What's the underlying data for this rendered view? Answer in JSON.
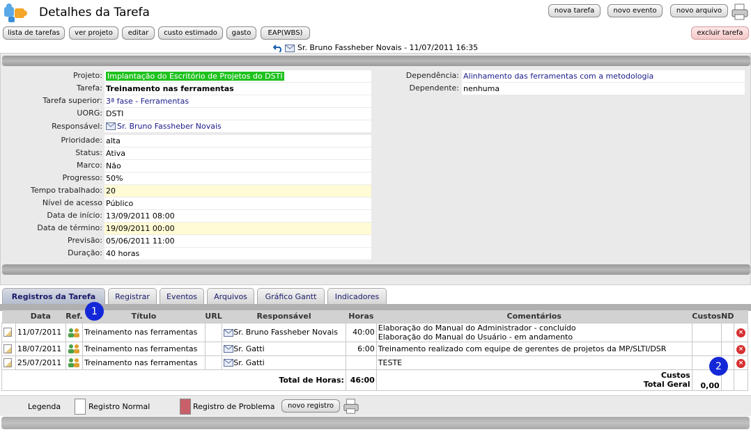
{
  "header": {
    "title": "Detalhes da Tarefa",
    "top_buttons": [
      "nova tarefa",
      "novo evento",
      "novo arquivo"
    ],
    "toolbar": [
      "lista de tarefas",
      "ver projeto",
      "editar",
      "custo estimado",
      "gasto",
      "EAP(WBS)"
    ],
    "delete_button": "excluir tarefa",
    "owner_line": "Sr. Bruno Fassheber Novais - 11/07/2011 16:35"
  },
  "details": {
    "left": [
      {
        "label": "Projeto:",
        "value": "Implantação do Escritório de Projetos do DSTI"
      },
      {
        "label": "Tarefa:",
        "value": "Treinamento nas ferramentas"
      },
      {
        "label": "Tarefa superior:",
        "value": "3ª fase - Ferramentas"
      },
      {
        "label": "UORG:",
        "value": "DSTI"
      },
      {
        "label": "Responsável:",
        "value": "Sr. Bruno Fassheber Novais"
      },
      {
        "label": "Prioridade:",
        "value": "alta"
      },
      {
        "label": "Status:",
        "value": "Ativa"
      },
      {
        "label": "Marco:",
        "value": "Não"
      },
      {
        "label": "Progresso:",
        "value": "50%"
      },
      {
        "label": "Tempo trabalhado:",
        "value": "20"
      },
      {
        "label": "Nível de acesso",
        "value": "Público"
      },
      {
        "label": "Data de início:",
        "value": "13/09/2011 08:00"
      },
      {
        "label": "Data de término:",
        "value": "19/09/2011 00:00"
      },
      {
        "label": "Previsão:",
        "value": "05/06/2011 11:00"
      },
      {
        "label": "Duração:",
        "value": "40 horas"
      }
    ],
    "right": [
      {
        "label": "Dependência:",
        "value": "Alinhamento das ferramentas com a metodologia"
      },
      {
        "label": "Dependente:",
        "value": "nenhuma"
      }
    ]
  },
  "tabs": [
    "Registros da Tarefa",
    "Registrar",
    "Eventos",
    "Arquivos",
    "Gráfico Gantt",
    "Indicadores"
  ],
  "log": {
    "columns": [
      "Data",
      "Ref.",
      "Título",
      "URL",
      "Responsável",
      "Horas",
      "Comentários",
      "Custos",
      "ND"
    ],
    "rows": [
      {
        "date": "11/07/2011",
        "title": "Treinamento nas ferramentas",
        "url": "",
        "owner": "Sr. Bruno Fassheber Novais",
        "hours": "40:00",
        "comment1": "Elaboração do Manual do Administrador - concluído",
        "comment2": "Elaboração do Manual do Usuário - em andamento",
        "cost": ""
      },
      {
        "date": "18/07/2011",
        "title": "Treinamento nas ferramentas",
        "url": "",
        "owner": "Sr. Gatti",
        "hours": "6:00",
        "comment1": "Treinamento realizado com equipe de gerentes de projetos da MP/SLTI/DSR",
        "comment2": "",
        "cost": ""
      },
      {
        "date": "25/07/2011",
        "title": "Treinamento nas ferramentas",
        "url": "",
        "owner": "Sr. Gatti",
        "hours": "",
        "comment1": "TESTE",
        "comment2": "",
        "cost": ""
      }
    ],
    "total_hours_label": "Total de Horas:",
    "total_hours": "46:00",
    "costs_label": "Custos",
    "total_general_label": "Total Geral",
    "total_general": "0,00"
  },
  "legend": {
    "label": "Legenda",
    "normal": "Registro Normal",
    "problem": "Registro de Problema",
    "new_button": "novo registro"
  },
  "badges": [
    "1",
    "2"
  ],
  "colors": {
    "project_highlight": "#1ec21e",
    "problem_swatch": "#c8606a",
    "badge": "#1428d8"
  }
}
